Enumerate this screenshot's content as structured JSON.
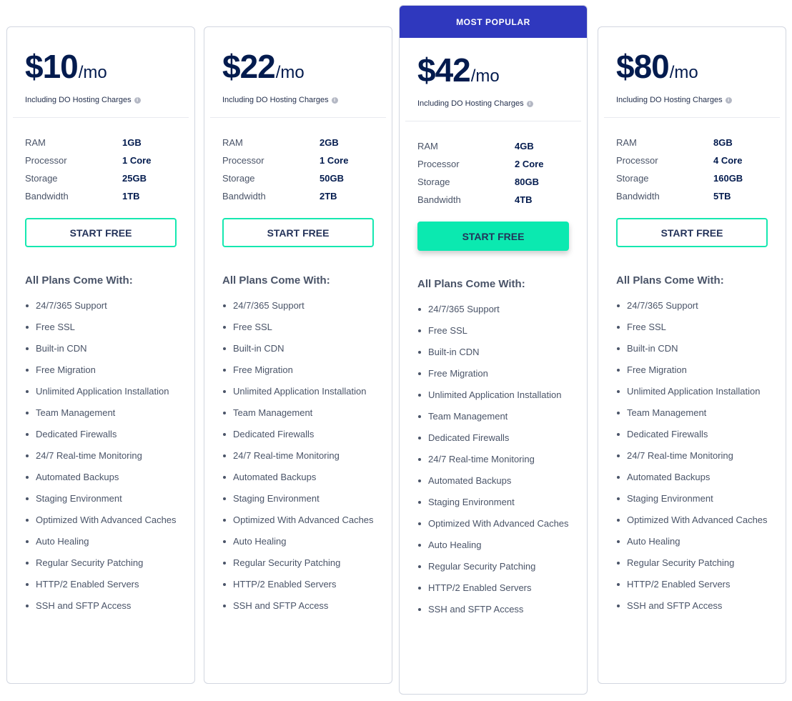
{
  "plans": [
    {
      "badge": null,
      "price": "$10",
      "period": "/mo",
      "note": "Including DO Hosting Charges",
      "specs": [
        {
          "label": "RAM",
          "value": "1GB"
        },
        {
          "label": "Processor",
          "value": "1 Core"
        },
        {
          "label": "Storage",
          "value": "25GB"
        },
        {
          "label": "Bandwidth",
          "value": "1TB"
        }
      ],
      "cta": "START FREE"
    },
    {
      "badge": null,
      "price": "$22",
      "period": "/mo",
      "note": "Including DO Hosting Charges",
      "specs": [
        {
          "label": "RAM",
          "value": "2GB"
        },
        {
          "label": "Processor",
          "value": "1 Core"
        },
        {
          "label": "Storage",
          "value": "50GB"
        },
        {
          "label": "Bandwidth",
          "value": "2TB"
        }
      ],
      "cta": "START FREE"
    },
    {
      "badge": "MOST POPULAR",
      "price": "$42",
      "period": "/mo",
      "note": "Including DO Hosting Charges",
      "specs": [
        {
          "label": "RAM",
          "value": "4GB"
        },
        {
          "label": "Processor",
          "value": "2 Core"
        },
        {
          "label": "Storage",
          "value": "80GB"
        },
        {
          "label": "Bandwidth",
          "value": "4TB"
        }
      ],
      "cta": "START FREE"
    },
    {
      "badge": null,
      "price": "$80",
      "period": "/mo",
      "note": "Including DO Hosting Charges",
      "specs": [
        {
          "label": "RAM",
          "value": "8GB"
        },
        {
          "label": "Processor",
          "value": "4 Core"
        },
        {
          "label": "Storage",
          "value": "160GB"
        },
        {
          "label": "Bandwidth",
          "value": "5TB"
        }
      ],
      "cta": "START FREE"
    }
  ],
  "features_heading": "All Plans Come With:",
  "features": [
    "24/7/365 Support",
    "Free SSL",
    "Built-in CDN",
    "Free Migration",
    "Unlimited Application Installation",
    "Team Management",
    "Dedicated Firewalls",
    "24/7 Real-time Monitoring",
    "Automated Backups",
    "Staging Environment",
    "Optimized With Advanced Caches",
    "Auto Healing",
    "Regular Security Patching",
    "HTTP/2 Enabled Servers",
    "SSH and SFTP Access"
  ],
  "icons": {
    "info": "info-circle-icon"
  },
  "colors": {
    "badge": "#2f38be",
    "accent": "#0be9b0",
    "text": "#031b4e"
  }
}
